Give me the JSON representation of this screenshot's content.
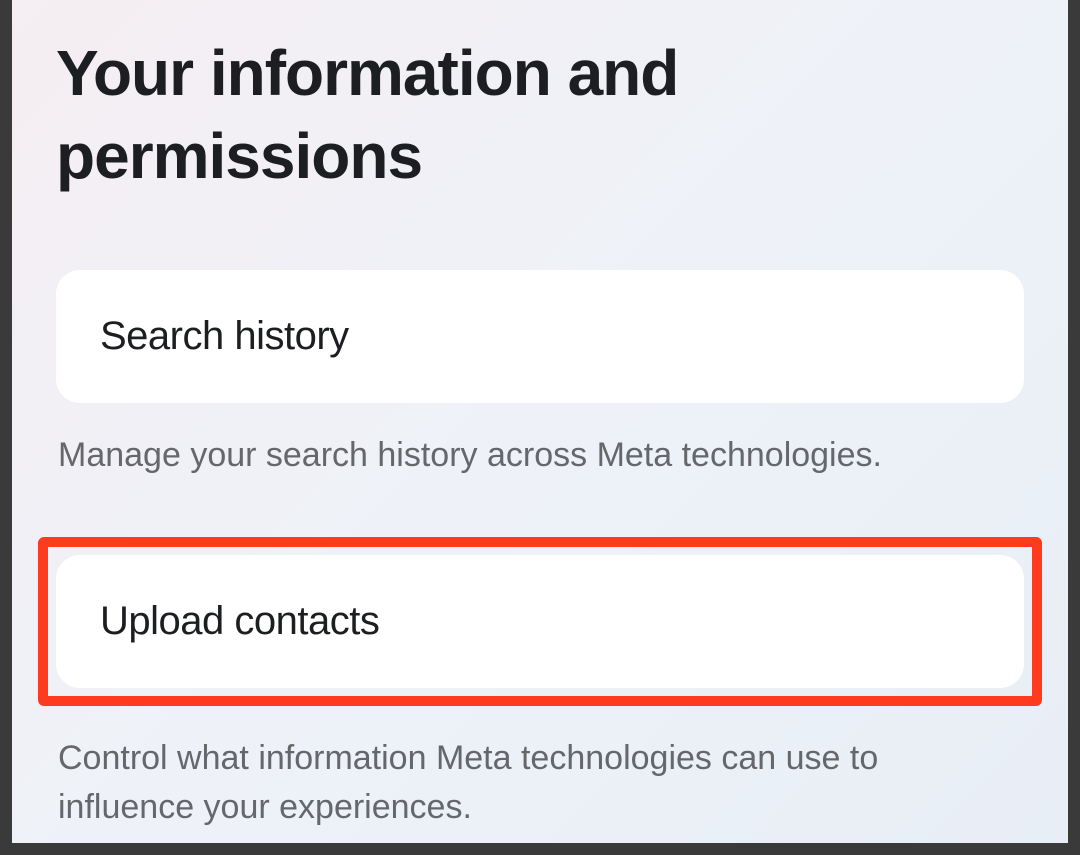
{
  "page": {
    "title": "Your information and permissions"
  },
  "sections": {
    "search_history": {
      "title": "Search history",
      "description": "Manage your search history across Meta technologies."
    },
    "upload_contacts": {
      "title": "Upload contacts",
      "description": "Control what information Meta technologies can use to influence your experiences."
    }
  }
}
